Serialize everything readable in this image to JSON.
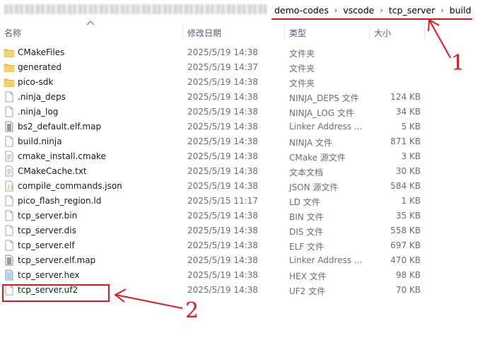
{
  "breadcrumb": [
    "demo-codes",
    "vscode",
    "tcp_server",
    "build"
  ],
  "columns": {
    "name": "名称",
    "date": "修改日期",
    "type": "类型",
    "size": "大小"
  },
  "files": [
    {
      "name": "CMakeFiles",
      "date": "2025/5/19 14:38",
      "type": "文件夹",
      "size": "",
      "icon": "folder-icon"
    },
    {
      "name": "generated",
      "date": "2025/5/19 14:37",
      "type": "文件夹",
      "size": "",
      "icon": "folder-icon"
    },
    {
      "name": "pico-sdk",
      "date": "2025/5/19 14:38",
      "type": "文件夹",
      "size": "",
      "icon": "folder-icon"
    },
    {
      "name": ".ninja_deps",
      "date": "2025/5/19 14:38",
      "type": "NINJA_DEPS 文件",
      "size": "124 KB",
      "icon": "file-icon"
    },
    {
      "name": ".ninja_log",
      "date": "2025/5/19 14:38",
      "type": "NINJA_LOG 文件",
      "size": "34 KB",
      "icon": "file-icon"
    },
    {
      "name": "bs2_default.elf.map",
      "date": "2025/5/19 14:38",
      "type": "Linker Address ...",
      "size": "5 KB",
      "icon": "map-file-icon"
    },
    {
      "name": "build.ninja",
      "date": "2025/5/19 14:38",
      "type": "NINJA 文件",
      "size": "871 KB",
      "icon": "file-icon"
    },
    {
      "name": "cmake_install.cmake",
      "date": "2025/5/19 14:38",
      "type": "CMake 源文件",
      "size": "3 KB",
      "icon": "text-file-icon"
    },
    {
      "name": "CMakeCache.txt",
      "date": "2025/5/19 14:38",
      "type": "文本文档",
      "size": "30 KB",
      "icon": "text-file-icon"
    },
    {
      "name": "compile_commands.json",
      "date": "2025/5/19 14:38",
      "type": "JSON 源文件",
      "size": "584 KB",
      "icon": "json-file-icon"
    },
    {
      "name": "pico_flash_region.ld",
      "date": "2025/5/15 11:17",
      "type": "LD 文件",
      "size": "1 KB",
      "icon": "file-icon"
    },
    {
      "name": "tcp_server.bin",
      "date": "2025/5/19 14:38",
      "type": "BIN 文件",
      "size": "35 KB",
      "icon": "file-icon"
    },
    {
      "name": "tcp_server.dis",
      "date": "2025/5/19 14:38",
      "type": "DIS 文件",
      "size": "558 KB",
      "icon": "file-icon"
    },
    {
      "name": "tcp_server.elf",
      "date": "2025/5/19 14:38",
      "type": "ELF 文件",
      "size": "697 KB",
      "icon": "file-icon"
    },
    {
      "name": "tcp_server.elf.map",
      "date": "2025/5/19 14:38",
      "type": "Linker Address ...",
      "size": "470 KB",
      "icon": "map-file-icon"
    },
    {
      "name": "tcp_server.hex",
      "date": "2025/5/19 14:38",
      "type": "HEX 文件",
      "size": "98 KB",
      "icon": "hex-file-icon"
    },
    {
      "name": "tcp_server.uf2",
      "date": "2025/5/19 14:38",
      "type": "UF2 文件",
      "size": "70 KB",
      "icon": "file-icon"
    }
  ],
  "annotations": {
    "one": "1",
    "two": "2"
  },
  "colors": {
    "accent_red": "#e8141b",
    "folder": "#f3c452",
    "header_text": "#4c607a"
  }
}
